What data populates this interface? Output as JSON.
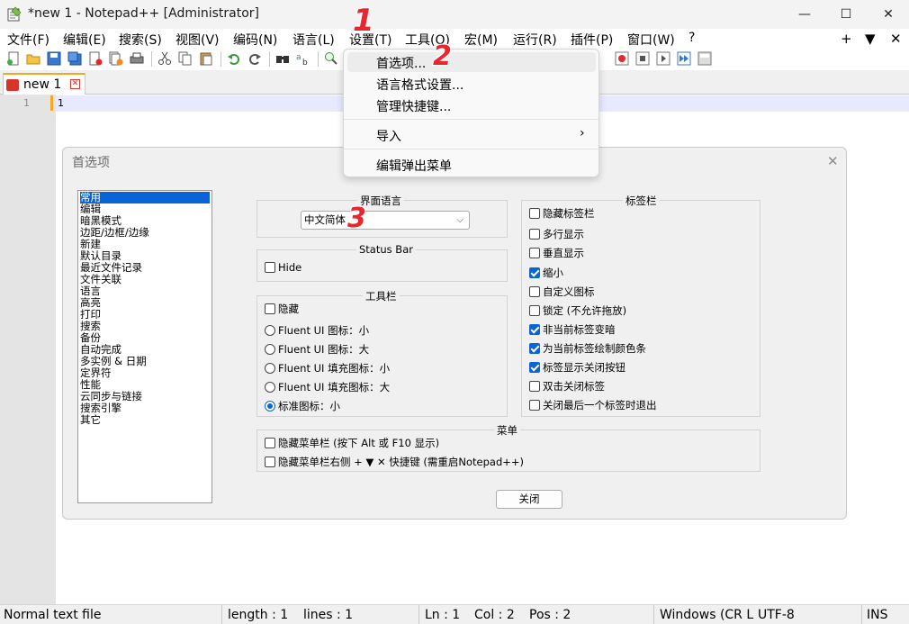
{
  "window": {
    "title": "*new 1 - Notepad++ [Administrator]",
    "minimize": "—",
    "maximize": "☐",
    "close": "✕"
  },
  "menubar": {
    "items": [
      "文件(F)",
      "编辑(E)",
      "搜索(S)",
      "视图(V)",
      "编码(N)",
      "语言(L)",
      "设置(T)",
      "工具(O)",
      "宏(M)",
      "运行(R)",
      "插件(P)",
      "窗口(W)",
      "?"
    ],
    "right_plus": "+",
    "right_down": "▼",
    "right_close": "✕"
  },
  "toolbar": {
    "icons": [
      "new-file-icon",
      "open-file-icon",
      "save-icon",
      "save-all-icon",
      "close-icon",
      "close-all-icon",
      "print-icon",
      "cut-icon",
      "copy-icon",
      "paste-icon",
      "undo-icon",
      "redo-icon",
      "find-icon",
      "replace-icon",
      "zoom-in-icon",
      "record-macro-icon",
      "stop-macro-icon",
      "play-macro-icon",
      "run-macro-multiple-icon",
      "save-macro-icon"
    ]
  },
  "tab": {
    "label": "new 1",
    "close": "✕"
  },
  "editor": {
    "line_number": "1",
    "line_text": "1"
  },
  "dropdown": {
    "items": [
      "首选项...",
      "语言格式设置...",
      "管理快捷键...",
      "导入",
      "编辑弹出菜单"
    ],
    "submenu_arrow": "›"
  },
  "markers": [
    "1",
    "2",
    "3"
  ],
  "preferences": {
    "title": "首选项",
    "close": "✕",
    "categories": [
      "常用",
      "编辑",
      "暗黑模式",
      "边距/边框/边缘",
      "新建",
      "默认目录",
      "最近文件记录",
      "文件关联",
      "语言",
      "高亮",
      "打印",
      "搜索",
      "备份",
      "自动完成",
      "多实例 & 日期",
      "定界符",
      "性能",
      "云同步与链接",
      "搜索引擎",
      "其它"
    ],
    "selected_category": "常用",
    "ui_language": {
      "title": "界面语言",
      "value": "中文简体",
      "arrow": "⌵"
    },
    "status_bar": {
      "title": "Status Bar",
      "hide": "Hide",
      "hide_checked": false
    },
    "toolbar_group": {
      "title": "工具栏",
      "hide": "隐藏",
      "hide_checked": false,
      "options": [
        "Fluent UI 图标：小",
        "Fluent UI 图标：大",
        "Fluent UI 填充图标：小",
        "Fluent UI 填充图标：大",
        "标准图标：小"
      ],
      "selected_index": 4
    },
    "tabbar_group": {
      "title": "标签栏",
      "options": [
        {
          "label": "隐藏标签栏",
          "checked": false
        },
        {
          "label": "多行显示",
          "checked": false
        },
        {
          "label": "垂直显示",
          "checked": false
        },
        {
          "label": "缩小",
          "checked": true
        },
        {
          "label": "自定义图标",
          "checked": false
        },
        {
          "label": "锁定 (不允许拖放)",
          "checked": false
        },
        {
          "label": "非当前标签变暗",
          "checked": true
        },
        {
          "label": "为当前标签绘制颜色条",
          "checked": true
        },
        {
          "label": "标签显示关闭按钮",
          "checked": true
        },
        {
          "label": "双击关闭标签",
          "checked": false
        },
        {
          "label": "关闭最后一个标签时退出",
          "checked": false
        }
      ]
    },
    "menu_group": {
      "title": "菜单",
      "options": [
        {
          "label": "隐藏菜单栏 (按下 Alt 或 F10 显示)",
          "checked": false
        },
        {
          "label": "隐藏菜单栏右侧 + ▼ ✕ 快捷键 (需重启Notepad++)",
          "checked": false
        }
      ]
    },
    "close_button": "关闭"
  },
  "statusbar": {
    "file_type": "Normal text file",
    "length": "length : 1",
    "lines": "lines : 1",
    "ln": "Ln : 1",
    "col": "Col : 2",
    "pos": "Pos : 2",
    "eol": "Windows (CR LF)",
    "encoding": "UTF-8",
    "mode": "INS"
  },
  "colors": {
    "accent": "#0a64d8",
    "marker": "#e8262d",
    "tab_accent": "#f5a623",
    "current_line": "#e8e8ff"
  }
}
